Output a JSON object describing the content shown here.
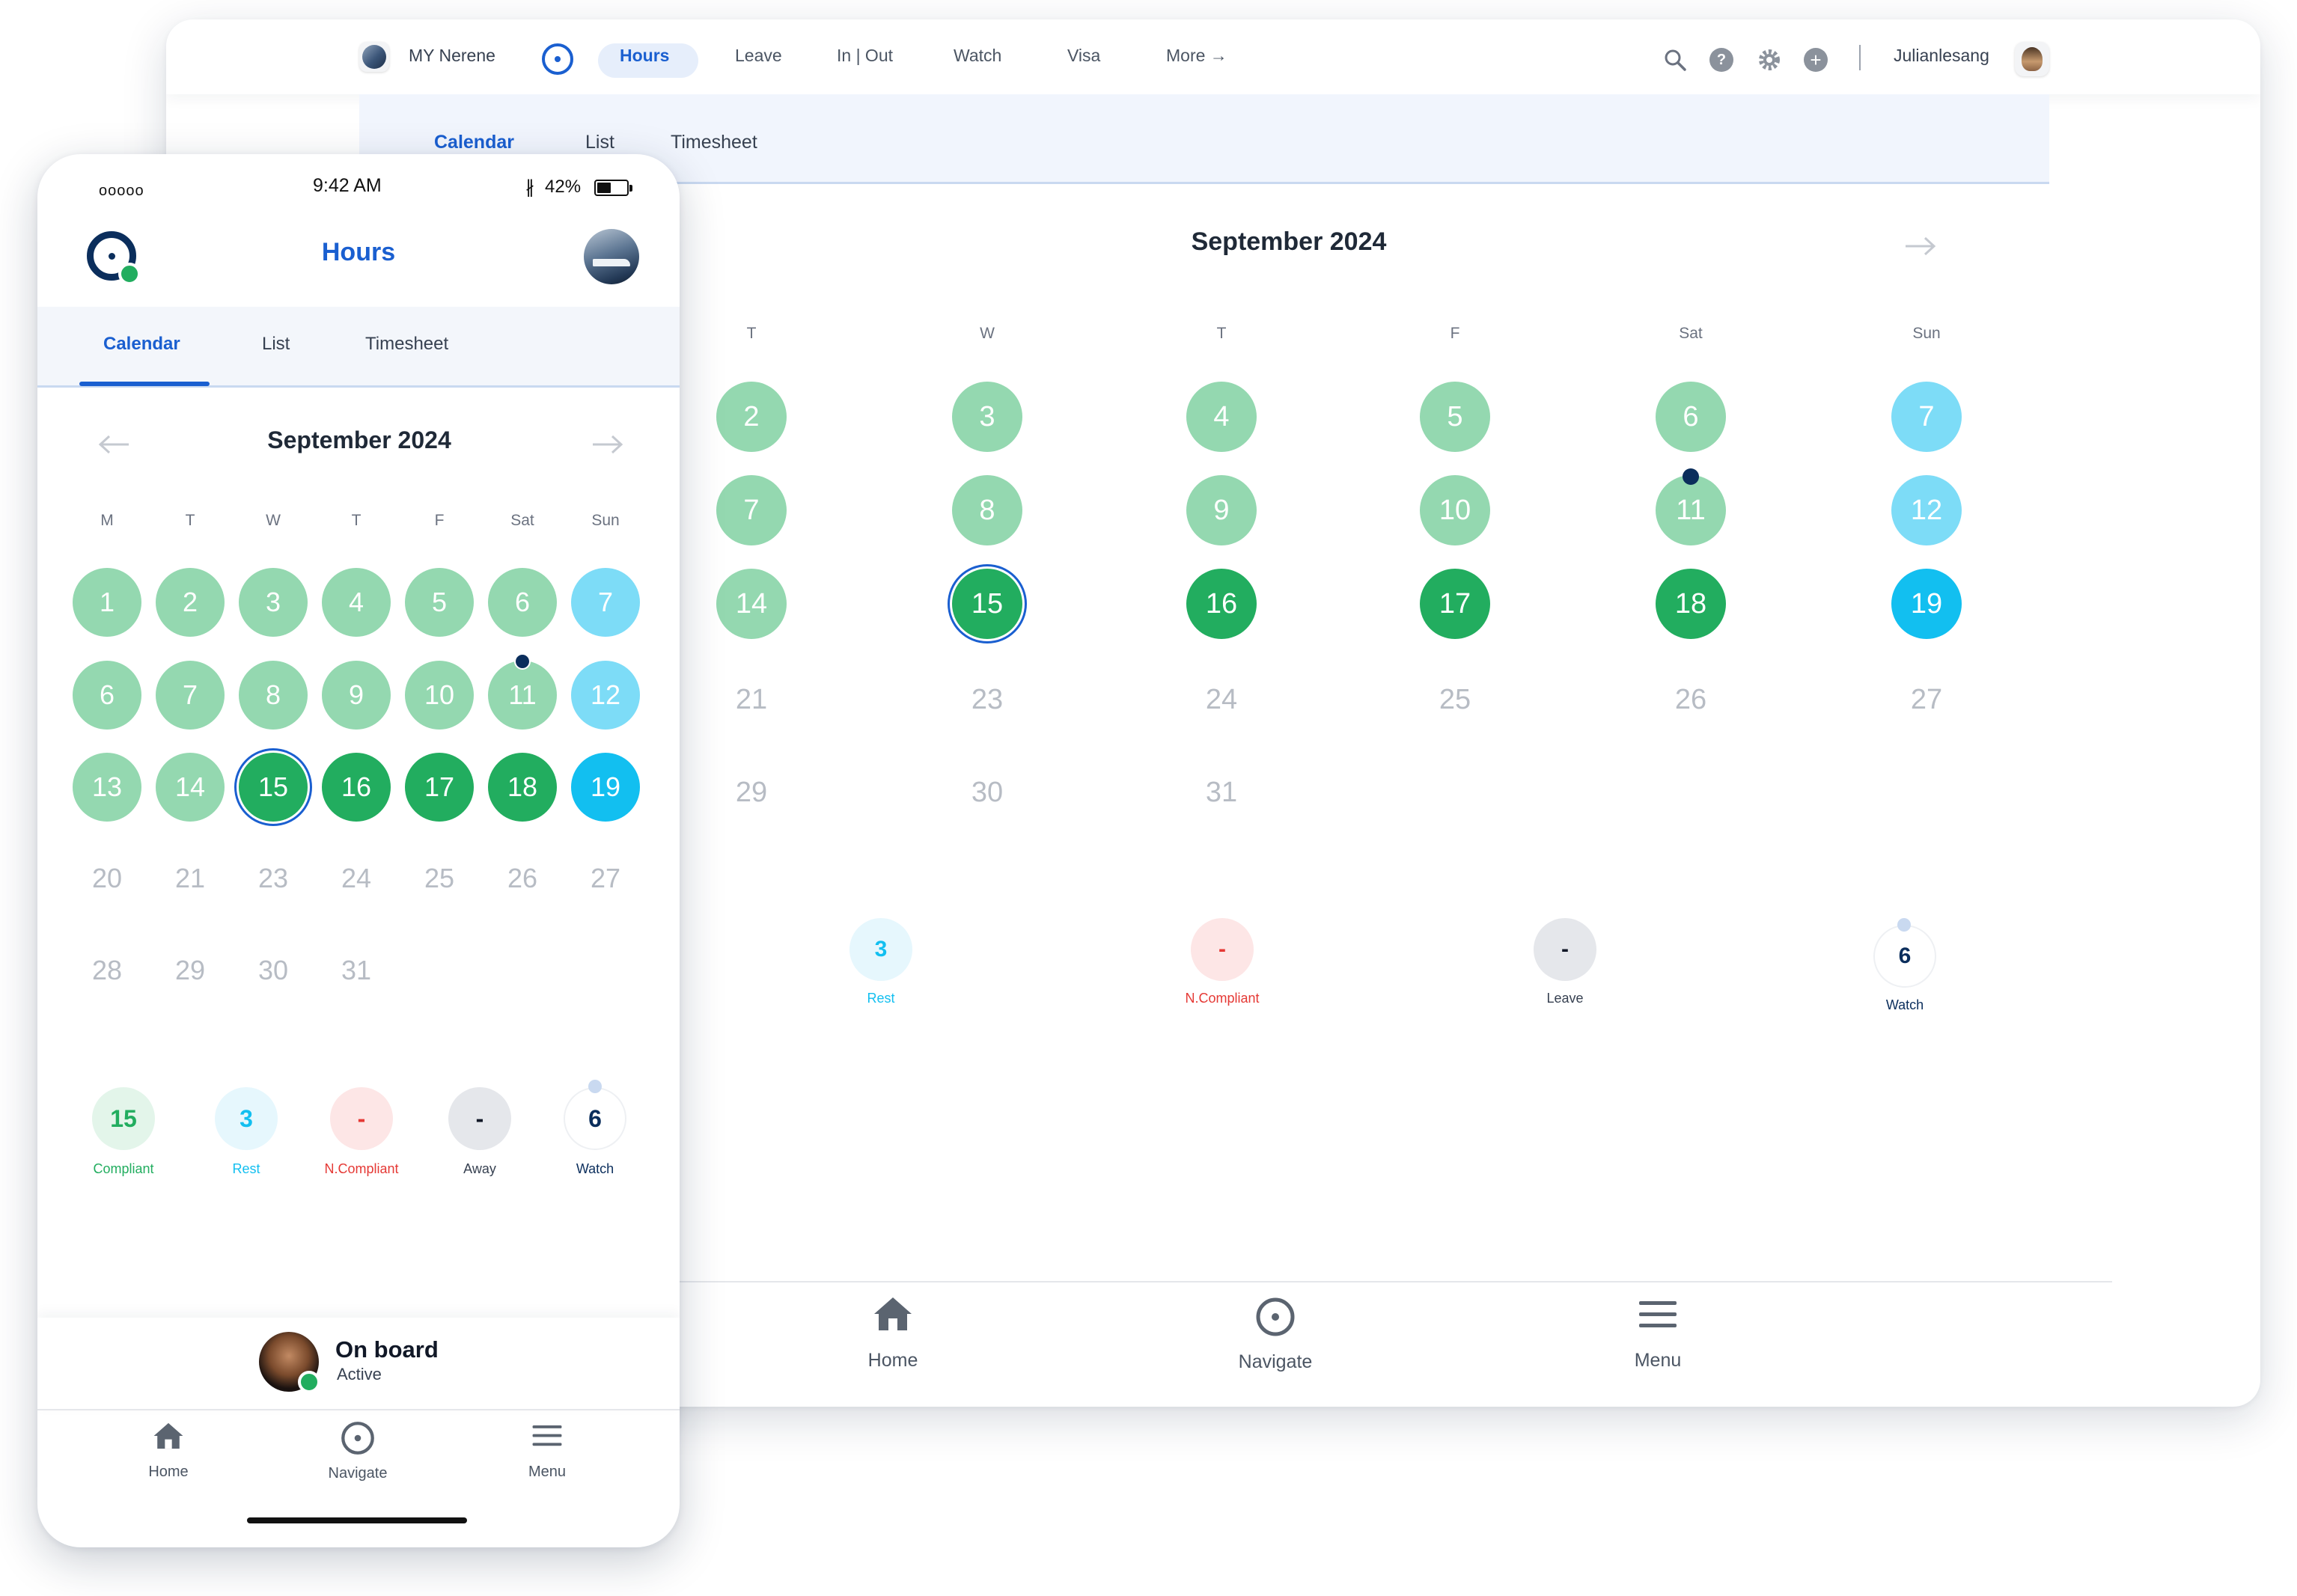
{
  "desktop": {
    "vessel_name": "MY Nerene",
    "nav": [
      "Hours",
      "Leave",
      "In | Out",
      "Watch",
      "Visa",
      "More →"
    ],
    "active_nav": "Hours",
    "username": "Julianlesang",
    "subtabs": [
      "Calendar",
      "List",
      "Timesheet"
    ],
    "active_subtab": "Calendar",
    "month_title": "September 2024",
    "weekdays": [
      "T",
      "W",
      "T",
      "F",
      "Sat",
      "Sun"
    ],
    "rows": [
      [
        "2",
        "3",
        "4",
        "5",
        "6",
        "7"
      ],
      [
        "7",
        "8",
        "9",
        "10",
        "11",
        "12"
      ],
      [
        "14",
        "15",
        "16",
        "17",
        "18",
        "19"
      ],
      [
        "21",
        "23",
        "24",
        "25",
        "26",
        "27"
      ],
      [
        "29",
        "30",
        "31"
      ]
    ],
    "summary": [
      {
        "value": "3",
        "label": "Rest"
      },
      {
        "value": "-",
        "label": "N.Compliant"
      },
      {
        "value": "-",
        "label": "Leave"
      },
      {
        "value": "6",
        "label": "Watch"
      }
    ],
    "tabbar": [
      "Home",
      "Navigate",
      "Menu"
    ]
  },
  "phone": {
    "status": {
      "carrier": "ooooo",
      "time": "9:42 AM",
      "battery": "42%"
    },
    "title": "Hours",
    "subtabs": [
      "Calendar",
      "List",
      "Timesheet"
    ],
    "active_subtab": "Calendar",
    "month_title": "September 2024",
    "weekdays": [
      "M",
      "T",
      "W",
      "T",
      "F",
      "Sat",
      "Sun"
    ],
    "rows": [
      [
        "1",
        "2",
        "3",
        "4",
        "5",
        "6",
        "7"
      ],
      [
        "6",
        "7",
        "8",
        "9",
        "10",
        "11",
        "12"
      ],
      [
        "13",
        "14",
        "15",
        "16",
        "17",
        "18",
        "19"
      ],
      [
        "20",
        "21",
        "23",
        "24",
        "25",
        "26",
        "27"
      ],
      [
        "28",
        "29",
        "30",
        "31"
      ]
    ],
    "summary": [
      {
        "value": "15",
        "label": "Compliant"
      },
      {
        "value": "3",
        "label": "Rest"
      },
      {
        "value": "-",
        "label": "N.Compliant"
      },
      {
        "value": "-",
        "label": "Away"
      },
      {
        "value": "6",
        "label": "Watch"
      }
    ],
    "onboard": {
      "title": "On board",
      "status": "Active"
    },
    "tabbar": [
      "Home",
      "Navigate",
      "Menu"
    ]
  },
  "colors": {
    "brand_blue": "#1a5fd0",
    "navy": "#0b2e5c",
    "compliant_light": "#94d8b0",
    "compliant_dark": "#22ad5f",
    "rest_light": "#7ddcf7",
    "rest": "#12bff0",
    "non_compliant": "#e53935"
  }
}
